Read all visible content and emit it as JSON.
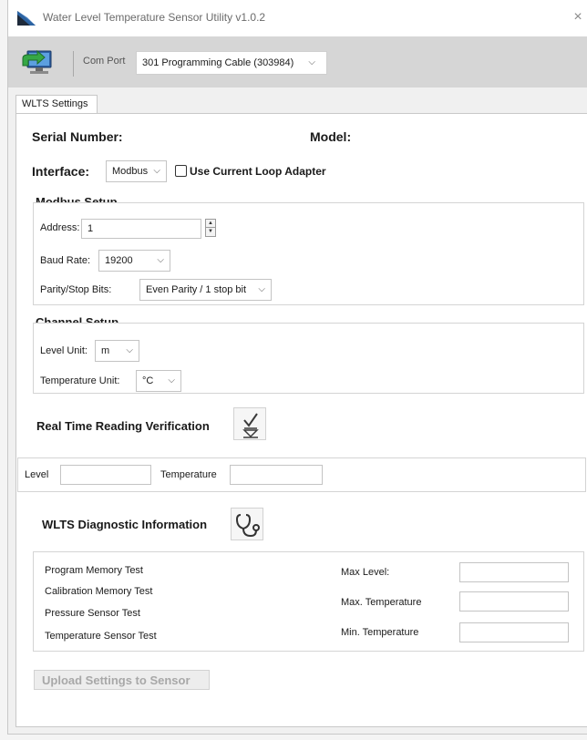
{
  "window": {
    "title": "Water Level Temperature Sensor Utility v1.0.2",
    "close_glyph": "×"
  },
  "toolbar": {
    "connect_icon": "connect-monitor-icon",
    "com_port_label": "Com Port",
    "com_port_value": "301 Programming Cable (303984)"
  },
  "tabs": [
    {
      "label": "WLTS Settings",
      "active": true
    }
  ],
  "device": {
    "serial_number_label": "Serial Number:",
    "serial_number_value": "",
    "model_label": "Model:",
    "model_value": ""
  },
  "interface": {
    "label": "Interface:",
    "value": "Modbus",
    "current_loop_label": "Use Current Loop Adapter",
    "current_loop_checked": false
  },
  "modbus_setup": {
    "title": "Modbus Setup",
    "address_label": "Address:",
    "address_value": "1",
    "baud_rate_label": "Baud Rate:",
    "baud_rate_value": "19200",
    "parity_label": "Parity/Stop Bits:",
    "parity_value": "Even Parity / 1 stop bit"
  },
  "channel_setup": {
    "title": "Channel Setup",
    "level_unit_label": "Level Unit:",
    "level_unit_value": "m",
    "temp_unit_label": "Temperature Unit:",
    "temp_unit_value": "°C"
  },
  "realtime": {
    "title": "Real Time Reading Verification",
    "icon": "verify-checkmark-icon",
    "level_label": "Level",
    "level_value": "",
    "temperature_label": "Temperature",
    "temperature_value": ""
  },
  "diagnostics": {
    "title": "WLTS Diagnostic Information",
    "icon": "stethoscope-icon",
    "tests": [
      "Program Memory Test",
      "Calibration Memory Test",
      "Pressure Sensor Test",
      "Temperature Sensor Test"
    ],
    "max_level_label": "Max Level:",
    "max_level_value": "",
    "max_temp_label": "Max. Temperature",
    "max_temp_value": "",
    "min_temp_label": "Min. Temperature",
    "min_temp_value": ""
  },
  "actions": {
    "upload_label": "Upload Settings to Sensor",
    "upload_enabled": false
  }
}
